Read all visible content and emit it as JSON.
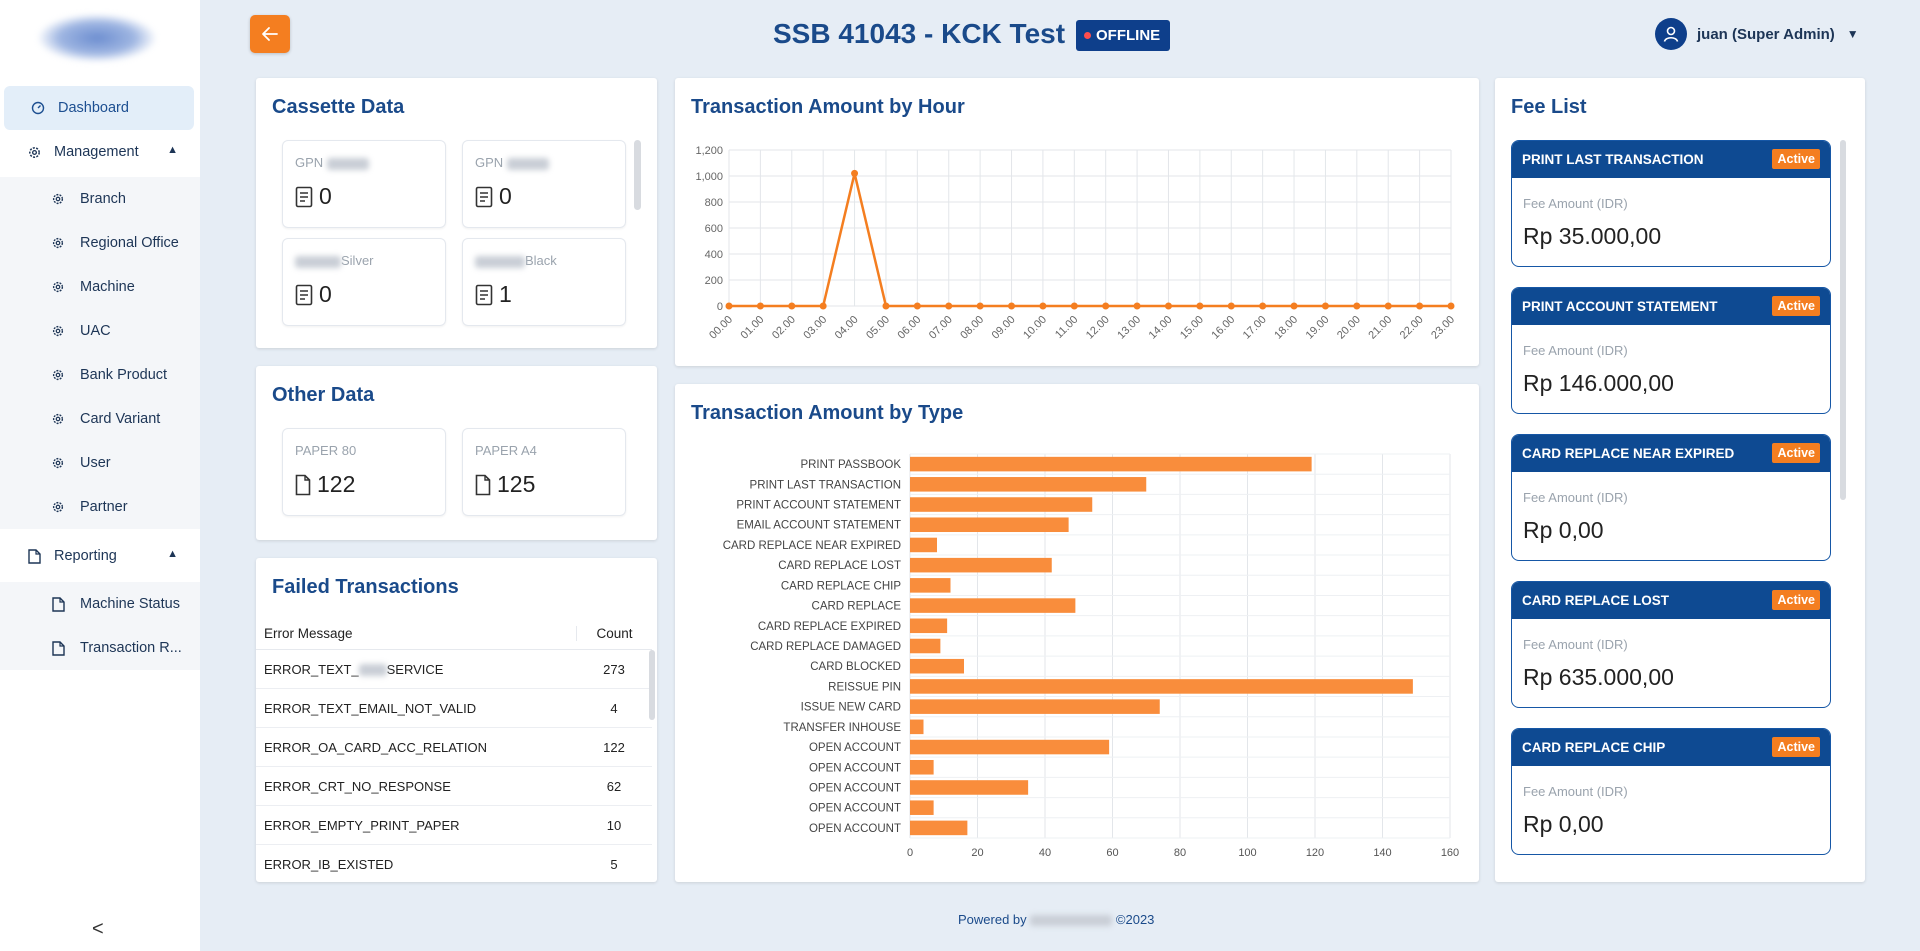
{
  "sidebar": {
    "items": [
      {
        "label": "Dashboard",
        "icon": "gauge-icon"
      },
      {
        "label": "Management",
        "icon": "gear-icon"
      },
      {
        "label": "Branch",
        "icon": "gear-icon"
      },
      {
        "label": "Regional Office",
        "icon": "gear-icon"
      },
      {
        "label": "Machine",
        "icon": "gear-icon"
      },
      {
        "label": "UAC",
        "icon": "gear-icon"
      },
      {
        "label": "Bank Product",
        "icon": "gear-icon"
      },
      {
        "label": "Card Variant",
        "icon": "gear-icon"
      },
      {
        "label": "User",
        "icon": "gear-icon"
      },
      {
        "label": "Partner",
        "icon": "gear-icon"
      },
      {
        "label": "Reporting",
        "icon": "document-icon"
      },
      {
        "label": "Machine Status",
        "icon": "document-icon"
      },
      {
        "label": "Transaction R...",
        "icon": "document-icon"
      }
    ],
    "collapse_glyph": "<"
  },
  "header": {
    "title": "SSB 41043 - KCK Test",
    "status": "OFFLINE",
    "status_color": "#ff4d4d",
    "user": "juan (Super Admin)",
    "accent": "#f47e20",
    "brand": "#0e3f8b"
  },
  "cassette": {
    "title": "Cassette Data",
    "items": [
      {
        "label": "GPN",
        "value": "0"
      },
      {
        "label": "GPN",
        "value": "0"
      },
      {
        "label": "Silver",
        "value": "0"
      },
      {
        "label": "Black",
        "value": "1"
      }
    ]
  },
  "other": {
    "title": "Other Data",
    "items": [
      {
        "label": "PAPER 80",
        "value": "122"
      },
      {
        "label": "PAPER A4",
        "value": "125"
      }
    ]
  },
  "failed": {
    "title": "Failed Transactions",
    "headers": {
      "message": "Error Message",
      "count": "Count"
    },
    "rows": [
      {
        "message_a": "ERROR_TEXT_",
        "message_b": "SERVICE",
        "count": "273"
      },
      {
        "message_a": "ERROR_TEXT_EMAIL_NOT_VALID",
        "message_b": "",
        "count": "4"
      },
      {
        "message_a": "ERROR_OA_CARD_ACC_RELATION",
        "message_b": "",
        "count": "122"
      },
      {
        "message_a": "ERROR_CRT_NO_RESPONSE",
        "message_b": "",
        "count": "62"
      },
      {
        "message_a": "ERROR_EMPTY_PRINT_PAPER",
        "message_b": "",
        "count": "10"
      },
      {
        "message_a": "ERROR_IB_EXISTED",
        "message_b": "",
        "count": "5"
      }
    ]
  },
  "chart_data": [
    {
      "type": "line",
      "title": "Transaction Amount by Hour",
      "x": [
        "00.00",
        "01.00",
        "02.00",
        "03.00",
        "04.00",
        "05.00",
        "06.00",
        "07.00",
        "08.00",
        "09.00",
        "10.00",
        "11.00",
        "12.00",
        "13.00",
        "14.00",
        "15.00",
        "16.00",
        "17.00",
        "18.00",
        "19.00",
        "20.00",
        "21.00",
        "22.00",
        "23.00"
      ],
      "y": [
        0,
        0,
        0,
        0,
        1020,
        0,
        0,
        0,
        0,
        0,
        0,
        0,
        0,
        0,
        0,
        0,
        0,
        0,
        0,
        0,
        0,
        0,
        0,
        0
      ],
      "yticks": [
        "0",
        "200",
        "400",
        "600",
        "800",
        "1,000",
        "1,200"
      ],
      "ylim": [
        0,
        1200
      ],
      "grid": true,
      "color": "#f47e20"
    },
    {
      "type": "bar",
      "orientation": "horizontal",
      "title": "Transaction Amount by Type",
      "categories": [
        "PRINT PASSBOOK",
        "PRINT LAST TRANSACTION",
        "PRINT ACCOUNT STATEMENT",
        "EMAIL ACCOUNT STATEMENT",
        "CARD REPLACE NEAR EXPIRED",
        "CARD REPLACE LOST",
        "CARD REPLACE CHIP",
        "CARD REPLACE",
        "CARD REPLACE EXPIRED",
        "CARD REPLACE DAMAGED",
        "CARD BLOCKED",
        "REISSUE PIN",
        "ISSUE NEW CARD",
        "TRANSFER INHOUSE",
        "OPEN ACCOUNT",
        "OPEN ACCOUNT",
        "OPEN ACCOUNT",
        "OPEN ACCOUNT",
        "OPEN ACCOUNT"
      ],
      "values": [
        119,
        70,
        54,
        47,
        8,
        42,
        12,
        49,
        11,
        9,
        16,
        149,
        74,
        4,
        59,
        7,
        35,
        7,
        17
      ],
      "xticks": [
        "0",
        "20",
        "40",
        "60",
        "80",
        "100",
        "120",
        "140",
        "160"
      ],
      "xlim": [
        0,
        160
      ],
      "grid": true,
      "color": "#f98d3c"
    }
  ],
  "fees": {
    "title": "Fee List",
    "items": [
      {
        "name": "PRINT LAST TRANSACTION",
        "status": "Active",
        "label": "Fee Amount (IDR)",
        "amount": "Rp 35.000,00"
      },
      {
        "name": "PRINT ACCOUNT STATEMENT",
        "status": "Active",
        "label": "Fee Amount (IDR)",
        "amount": "Rp 146.000,00"
      },
      {
        "name": "CARD REPLACE NEAR EXPIRED",
        "status": "Active",
        "label": "Fee Amount (IDR)",
        "amount": "Rp 0,00"
      },
      {
        "name": "CARD REPLACE LOST",
        "status": "Active",
        "label": "Fee Amount (IDR)",
        "amount": "Rp 635.000,00"
      },
      {
        "name": "CARD REPLACE CHIP",
        "status": "Active",
        "label": "Fee Amount (IDR)",
        "amount": "Rp 0,00"
      }
    ]
  },
  "footer": {
    "prefix": "Powered by",
    "suffix": "©2023"
  }
}
